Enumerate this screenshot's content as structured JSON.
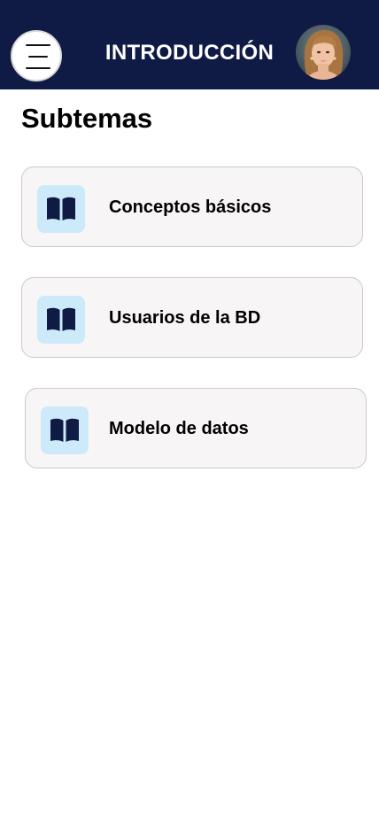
{
  "header": {
    "title": "INTRODUCCIÓN",
    "menu_icon": "hamburger-menu-icon",
    "avatar": "user-avatar-photo"
  },
  "main": {
    "section_title": "Subtemas",
    "items": [
      {
        "label": "Conceptos básicos",
        "icon": "open-book-icon"
      },
      {
        "label": "Usuarios de la BD",
        "icon": "open-book-icon"
      },
      {
        "label": "Modelo de datos",
        "icon": "open-book-icon"
      }
    ]
  },
  "colors": {
    "header_bg": "#0f1b45",
    "icon_bg": "#cdeafb",
    "icon_fg": "#0f1b45",
    "card_bg": "#f7f5f6",
    "card_border": "#c9c9c9"
  }
}
